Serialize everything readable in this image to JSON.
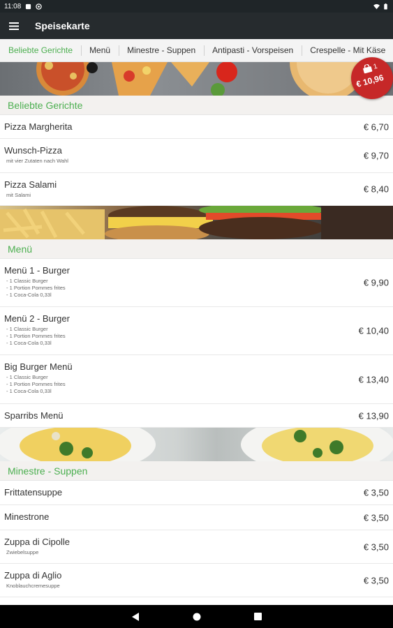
{
  "status": {
    "time": "11:08"
  },
  "appbar": {
    "title": "Speisekarte"
  },
  "tabs": [
    "Beliebte Gerichte",
    "Menü",
    "Minestre - Suppen",
    "Antipasti - Vorspeisen",
    "Crespelle - Mit Käse"
  ],
  "cart": {
    "count": "1",
    "total": "€ 10,96"
  },
  "sections": [
    {
      "title": "Beliebte Gerichte",
      "banner": "pizza-banner",
      "items": [
        {
          "name": "Pizza Margherita",
          "desc": "",
          "price": "€ 6,70"
        },
        {
          "name": "Wunsch-Pizza",
          "desc": "mit vier Zutaten nach Wahl",
          "price": "€ 9,70"
        },
        {
          "name": "Pizza Salami",
          "desc": "mit Salami",
          "price": "€ 8,40"
        }
      ]
    },
    {
      "title": "Menü",
      "banner": "burger-banner",
      "items": [
        {
          "name": "Menü 1 - Burger",
          "desc": "- 1 Classic Burger\n- 1 Portion Pommes frites\n- 1 Coca-Cola 0,33l",
          "price": "€ 9,90"
        },
        {
          "name": "Menü 2 - Burger",
          "desc": "- 1 Classic Burger\n- 1 Portion Pommes frites\n- 1 Coca-Cola 0,33l",
          "price": "€ 10,40"
        },
        {
          "name": "Big Burger Menü",
          "desc": "- 1 Classic Burger\n- 1 Portion Pommes frites\n- 1 Coca-Cola 0,33l",
          "price": "€ 13,40"
        },
        {
          "name": "Sparribs Menü",
          "desc": "",
          "price": "€ 13,90"
        }
      ]
    },
    {
      "title": "Minestre - Suppen",
      "banner": "soup-banner",
      "items": [
        {
          "name": "Frittatensuppe",
          "desc": "",
          "price": "€ 3,50"
        },
        {
          "name": "Minestrone",
          "desc": "",
          "price": "€ 3,50"
        },
        {
          "name": "Zuppa di Cipolle",
          "desc": "Zwiebelsuppe",
          "price": "€ 3,50"
        },
        {
          "name": "Zuppa di Aglio",
          "desc": "Knoblauchcremesuppe",
          "price": "€ 3,50"
        }
      ]
    }
  ]
}
